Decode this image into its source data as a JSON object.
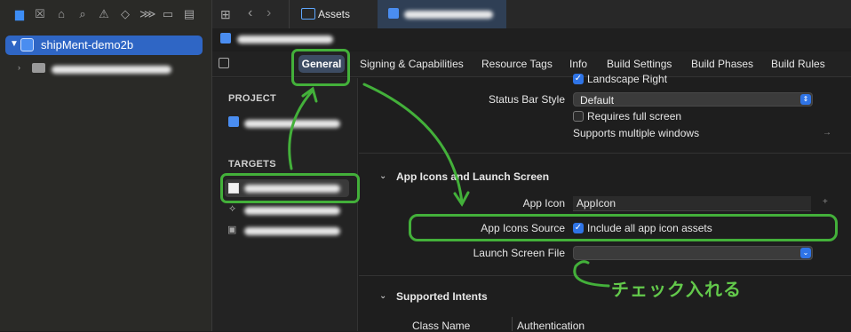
{
  "navigator": {
    "toolbar_icons": [
      "folder-icon",
      "source-control-icon",
      "symbol-icon",
      "find-icon",
      "warning-icon",
      "test-icon",
      "debug-icon",
      "breakpoint-icon",
      "report-icon"
    ],
    "project_name": "shipMent-demo2b"
  },
  "tabs": {
    "assets_label": "Assets"
  },
  "editor_tabs": [
    "General",
    "Signing & Capabilities",
    "Resource Tags",
    "Info",
    "Build Settings",
    "Build Phases",
    "Build Rules"
  ],
  "sidebar": {
    "project_header": "PROJECT",
    "targets_header": "TARGETS"
  },
  "deployment": {
    "landscape_right": "Landscape Right",
    "status_bar_style_label": "Status Bar Style",
    "status_bar_style_value": "Default",
    "requires_full_screen": "Requires full screen",
    "supports_multiple_windows": "Supports multiple windows"
  },
  "app_icons": {
    "section_title": "App Icons and Launch Screen",
    "app_icon_label": "App Icon",
    "app_icon_value": "AppIcon",
    "source_label": "App Icons Source",
    "source_checkbox": "Include all app icon assets",
    "launch_label": "Launch Screen File"
  },
  "intents": {
    "section_title": "Supported Intents",
    "col_class": "Class Name",
    "col_auth": "Authentication"
  },
  "annotation": "チェック入れる",
  "colors": {
    "accent": "#2f74e6",
    "annotation_green": "#43b03a",
    "selection": "#2f66c5"
  }
}
